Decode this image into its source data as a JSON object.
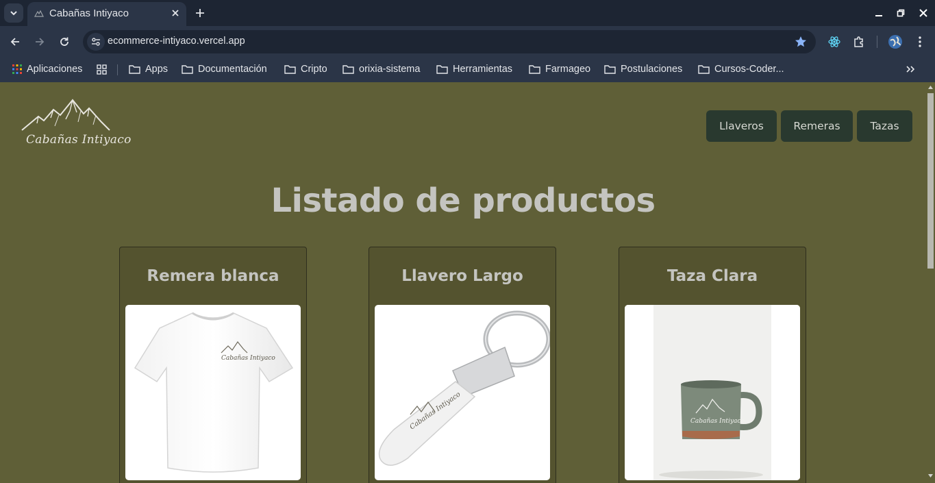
{
  "browser": {
    "tab_title": "Cabañas Intiyaco",
    "url": "ecommerce-intiyaco.vercel.app",
    "bookmarks": [
      "Aplicaciones",
      "Apps",
      "Documentación",
      "Cripto",
      "orixia-sistema",
      "Herramientas",
      "Farmageo",
      "Postulaciones",
      "Cursos-Coder..."
    ]
  },
  "site": {
    "logo_text": "Cabañas Intiyaco",
    "nav": [
      "Llaveros",
      "Remeras",
      "Tazas"
    ],
    "heading": "Listado de productos",
    "products": [
      {
        "title": "Remera blanca",
        "image": "white-tshirt-with-logo",
        "image_logo_text": "Cabañas Intiyaco"
      },
      {
        "title": "Llavero Largo",
        "image": "leather-keychain-with-logo",
        "image_logo_text": "Cabañas Intiyaco"
      },
      {
        "title": "Taza Clara",
        "image": "ceramic-mug-with-logo",
        "image_logo_text": "Cabañas Intiyaco"
      }
    ]
  },
  "colors": {
    "page_bg": "#5f5f37",
    "card_bg": "#54532f",
    "nav_button_bg": "#29392f",
    "heading_text": "#c4c4c0",
    "chrome_dark": "#1d2533",
    "chrome_mid": "#2b3547",
    "star_accent": "#8ab4f8"
  }
}
